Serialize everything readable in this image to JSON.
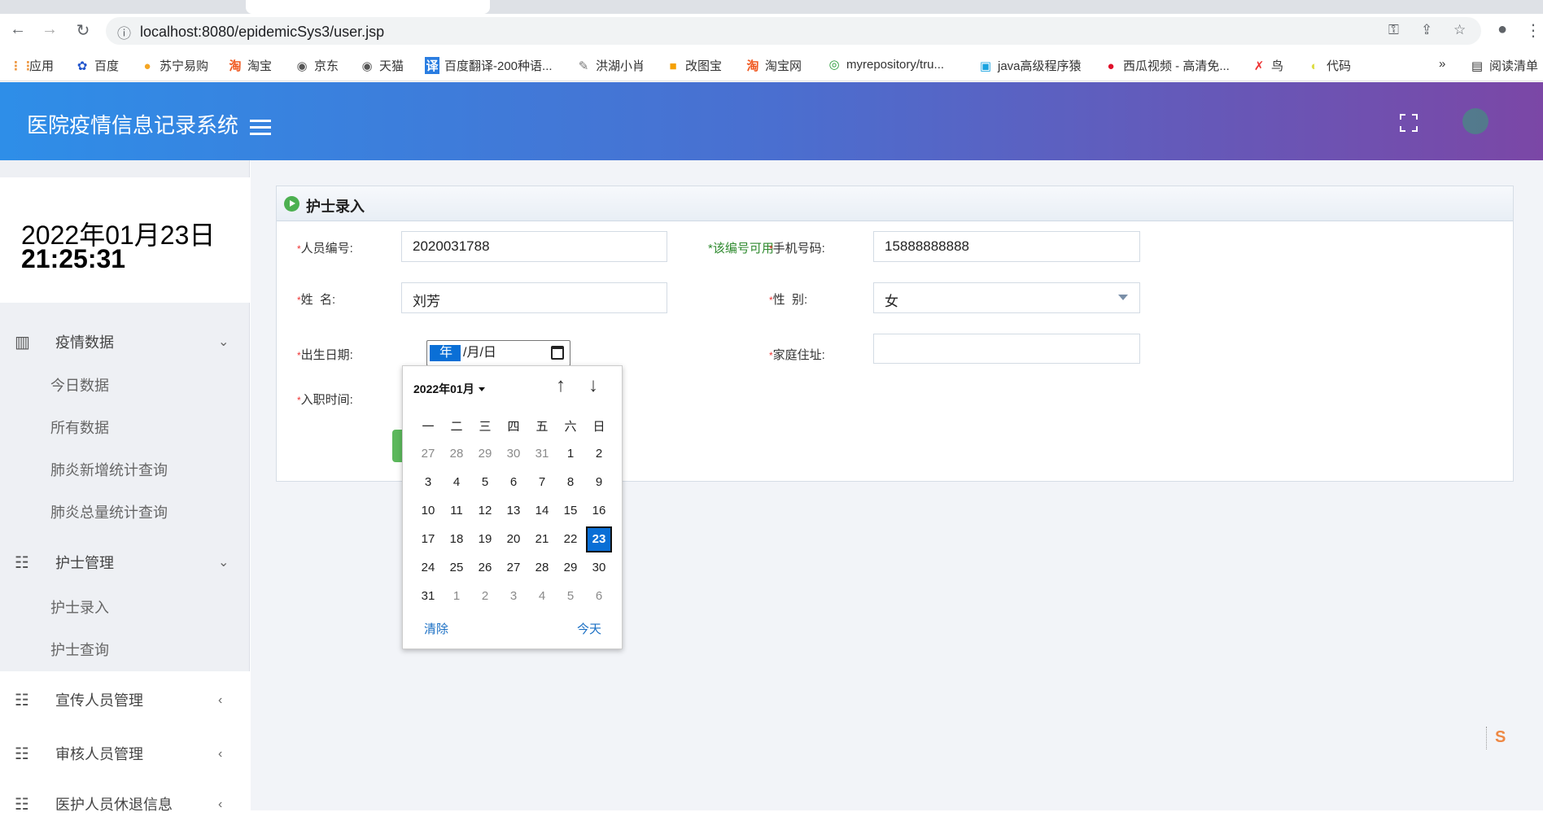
{
  "browser": {
    "url": "localhost:8080/epidemicSys3/user.jsp",
    "bookmarks": [
      "应用",
      "百度",
      "苏宁易购",
      "淘宝",
      "京东",
      "天猫",
      "百度翻译-200种语...",
      "洪湖小肖",
      "改图宝",
      "淘宝网",
      "myrepository/tru...",
      "java高级程序猿",
      "西瓜视频 - 高清免...",
      "鸟",
      "代码"
    ],
    "more": "»",
    "reading_list": "阅读清单"
  },
  "header": {
    "title": "医院疫情信息记录系统"
  },
  "sidebar": {
    "date": "2022年01月23日",
    "time": "21:25:31",
    "menus": [
      {
        "label": "疫情数据",
        "items": [
          "今日数据",
          "所有数据",
          "肺炎新增统计查询",
          "肺炎总量统计查询"
        ]
      },
      {
        "label": "护士管理",
        "items": [
          "护士录入",
          "护士查询"
        ]
      },
      {
        "label": "宣传人员管理"
      },
      {
        "label": "审核人员管理"
      },
      {
        "label": "医护人员休退信息"
      }
    ]
  },
  "form": {
    "title": "护士录入",
    "id_label": "人员编号:",
    "id_value": "2020031788",
    "id_status": "*该编号可用",
    "phone_label": "手机号码:",
    "phone_value": "15888888888",
    "name_label": "姓  名:",
    "name_value": "刘芳",
    "gender_label": "性  别:",
    "gender_value": "女",
    "birth_label": "出生日期:",
    "birth_year": "年",
    "birth_rest": "/月/日",
    "address_label": "家庭住址:",
    "address_value": "",
    "hire_label": "入职时间:"
  },
  "datepicker": {
    "month": "2022年01月",
    "weekdays": [
      "一",
      "二",
      "三",
      "四",
      "五",
      "六",
      "日"
    ],
    "days": [
      [
        "27",
        "28",
        "29",
        "30",
        "31",
        "1",
        "2"
      ],
      [
        "3",
        "4",
        "5",
        "6",
        "7",
        "8",
        "9"
      ],
      [
        "10",
        "11",
        "12",
        "13",
        "14",
        "15",
        "16"
      ],
      [
        "17",
        "18",
        "19",
        "20",
        "21",
        "22",
        "23"
      ],
      [
        "24",
        "25",
        "26",
        "27",
        "28",
        "29",
        "30"
      ],
      [
        "31",
        "1",
        "2",
        "3",
        "4",
        "5",
        "6"
      ]
    ],
    "selected": "23",
    "clear": "清除",
    "today": "今天"
  },
  "colors": {
    "accent": "#0a6fd6",
    "header_start": "#2e8ee8",
    "header_end": "#7b47a6",
    "ok": "#2f8a2f"
  }
}
